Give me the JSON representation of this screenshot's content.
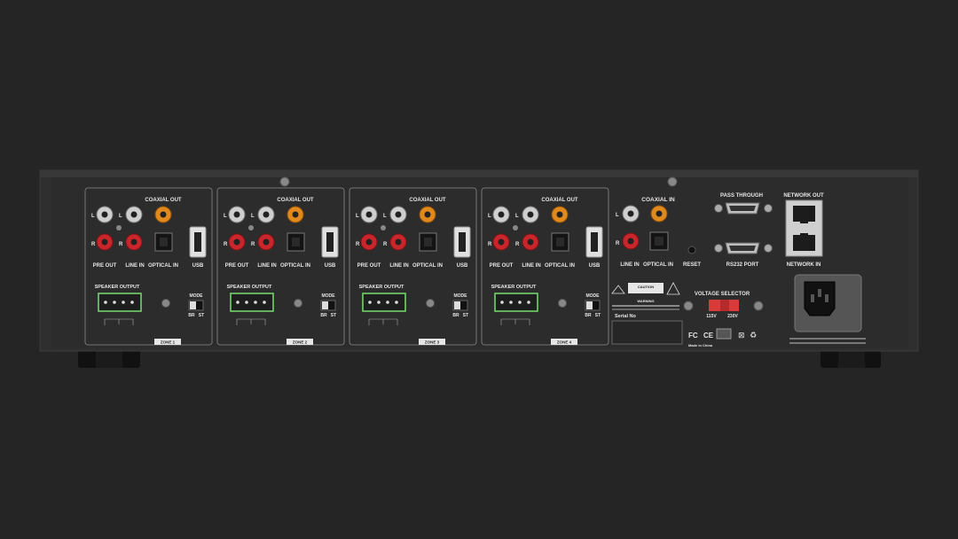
{
  "zones": [
    {
      "coaxial_out": "COAXIAL OUT",
      "pre_out": "PRE OUT",
      "line_in": "LINE IN",
      "optical_in": "OPTICAL IN",
      "usb": "USB",
      "speaker_output": "SPEAKER OUTPUT",
      "mode": "MODE",
      "br": "BR",
      "st": "ST",
      "zone": "ZONE 1",
      "l": "L",
      "r": "R"
    },
    {
      "coaxial_out": "COAXIAL OUT",
      "pre_out": "PRE OUT",
      "line_in": "LINE IN",
      "optical_in": "OPTICAL IN",
      "usb": "USB",
      "speaker_output": "SPEAKER OUTPUT",
      "mode": "MODE",
      "br": "BR",
      "st": "ST",
      "zone": "ZONE 2",
      "l": "L",
      "r": "R"
    },
    {
      "coaxial_out": "COAXIAL OUT",
      "pre_out": "PRE OUT",
      "line_in": "LINE IN",
      "optical_in": "OPTICAL IN",
      "usb": "USB",
      "speaker_output": "SPEAKER OUTPUT",
      "mode": "MODE",
      "br": "BR",
      "st": "ST",
      "zone": "ZONE 3",
      "l": "L",
      "r": "R"
    },
    {
      "coaxial_out": "COAXIAL OUT",
      "pre_out": "PRE OUT",
      "line_in": "LINE IN",
      "optical_in": "OPTICAL IN",
      "usb": "USB",
      "speaker_output": "SPEAKER OUTPUT",
      "mode": "MODE",
      "br": "BR",
      "st": "ST",
      "zone": "ZONE 4",
      "l": "L",
      "r": "R"
    }
  ],
  "source": {
    "coaxial_in": "COAXIAL IN",
    "line_in": "LINE IN",
    "optical_in": "OPTICAL IN",
    "reset": "RESET",
    "l": "L",
    "r": "R"
  },
  "control": {
    "pass_through": "PASS THROUGH",
    "rs232_port": "RS232 PORT",
    "network_out": "NETWORK OUT",
    "network_in": "NETWORK IN"
  },
  "power": {
    "caution": "CAUTION",
    "warning": "WARNING",
    "voltage_selector": "VOLTAGE SELECTOR",
    "v115": "115V",
    "v230": "230V",
    "serial_no": "Serial No",
    "made_in": "Made in China",
    "fc": "FC",
    "ce": "CE"
  },
  "colors": {
    "chassis": "#2c2c2c",
    "panel": "#363636",
    "rca_white": "#cfcfcf",
    "rca_red": "#c8262b",
    "rca_orange": "#e08a1e",
    "speaker_terminal": "#74d36b",
    "voltage_switch": "#d93a3a"
  }
}
